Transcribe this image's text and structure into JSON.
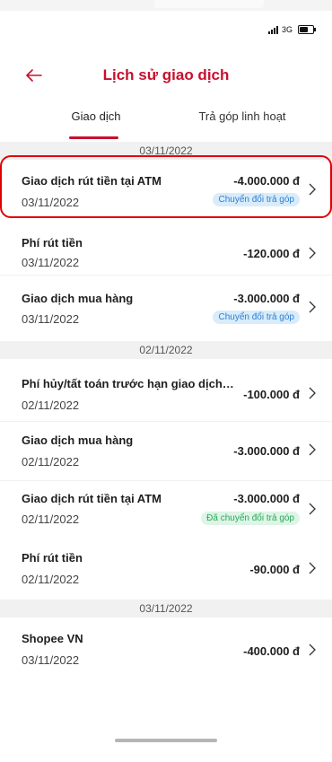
{
  "status": {
    "network": "3G"
  },
  "header": {
    "title": "Lịch sử giao dịch"
  },
  "tabs": [
    {
      "label": "Giao dịch",
      "active": true
    },
    {
      "label": "Trả góp linh hoạt",
      "active": false
    }
  ],
  "groups": [
    {
      "date": "03/11/2022",
      "items": [
        {
          "title": "Giao dịch rút tiền tại ATM",
          "date": "03/11/2022",
          "amount": "-4.000.000 đ",
          "badge": "Chuyển đổi trả góp"
        },
        {
          "title": "Phí rút tiền",
          "date": "03/11/2022",
          "amount": "-120.000 đ"
        },
        {
          "title": "Giao dịch mua hàng",
          "date": "03/11/2022",
          "amount": "-3.000.000 đ",
          "badge": "Chuyển đổi trả góp"
        }
      ]
    },
    {
      "date": "02/11/2022",
      "items": [
        {
          "title": "Phí hủy/tất toán trước hạn giao dịch tr...",
          "date": "02/11/2022",
          "amount": "-100.000 đ"
        },
        {
          "title": "Giao dịch mua hàng",
          "date": "02/11/2022",
          "amount": "-3.000.000 đ"
        },
        {
          "title": "Giao dịch rút tiền tại ATM",
          "date": "02/11/2022",
          "amount": "-3.000.000 đ",
          "badge": "Đã chuyển đổi trả góp"
        },
        {
          "title": "Phí rút tiền",
          "date": "02/11/2022",
          "amount": "-90.000 đ"
        }
      ]
    },
    {
      "date": "03/11/2022",
      "items": [
        {
          "title": "Shopee VN",
          "date": "03/11/2022",
          "amount": "-400.000 đ"
        }
      ]
    }
  ],
  "colors": {
    "accent": "#c8102e",
    "badge_blue": "#2d7ecf",
    "badge_green": "#2aa858",
    "highlight": "#e00000"
  },
  "icons": {
    "back": "arrow-left-icon",
    "row": "chevron-right-icon"
  }
}
